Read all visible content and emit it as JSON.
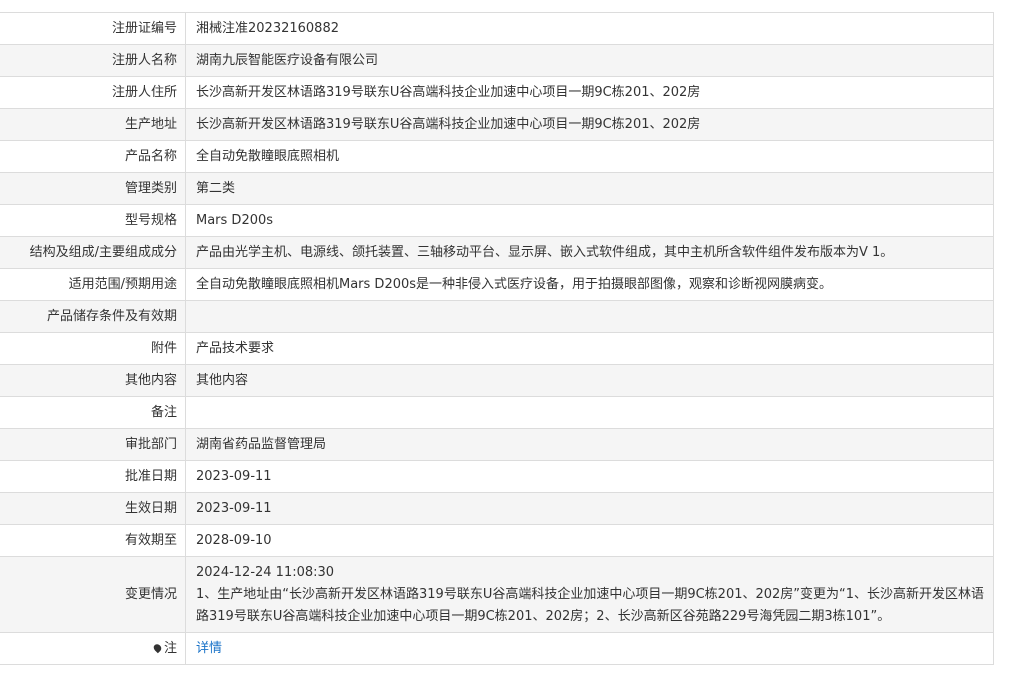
{
  "rows": [
    {
      "label": "注册证编号",
      "value": "湘械注准20232160882"
    },
    {
      "label": "注册人名称",
      "value": "湖南九辰智能医疗设备有限公司"
    },
    {
      "label": "注册人住所",
      "value": "长沙高新开发区林语路319号联东U谷高端科技企业加速中心项目一期9C栋201、202房"
    },
    {
      "label": "生产地址",
      "value": "长沙高新开发区林语路319号联东U谷高端科技企业加速中心项目一期9C栋201、202房"
    },
    {
      "label": "产品名称",
      "value": "全自动免散瞳眼底照相机"
    },
    {
      "label": "管理类别",
      "value": "第二类"
    },
    {
      "label": "型号规格",
      "value": "Mars D200s"
    },
    {
      "label": "结构及组成/主要组成成分",
      "value": "产品由光学主机、电源线、颌托装置、三轴移动平台、显示屏、嵌入式软件组成，其中主机所含软件组件发布版本为V 1。"
    },
    {
      "label": "适用范围/预期用途",
      "value": "全自动免散瞳眼底照相机Mars D200s是一种非侵入式医疗设备，用于拍摄眼部图像，观察和诊断视网膜病变。"
    },
    {
      "label": "产品储存条件及有效期",
      "value": ""
    },
    {
      "label": "附件",
      "value": "产品技术要求"
    },
    {
      "label": "其他内容",
      "value": "其他内容"
    },
    {
      "label": "备注",
      "value": ""
    },
    {
      "label": "审批部门",
      "value": "湖南省药品监督管理局"
    },
    {
      "label": "批准日期",
      "value": "2023-09-11"
    },
    {
      "label": "生效日期",
      "value": "2023-09-11"
    },
    {
      "label": "有效期至",
      "value": "2028-09-10"
    }
  ],
  "change": {
    "label": "变更情况",
    "time": "2024-12-24 11:08:30",
    "text": "1、生产地址由“长沙高新开发区林语路319号联东U谷高端科技企业加速中心项目一期9C栋201、202房”变更为“1、长沙高新开发区林语路319号联东U谷高端科技企业加速中心项目一期9C栋201、202房；2、长沙高新区谷苑路229号海凭园二期3栋101”。"
  },
  "note": {
    "label": "注",
    "icon": "pin-icon",
    "link": "详情"
  }
}
